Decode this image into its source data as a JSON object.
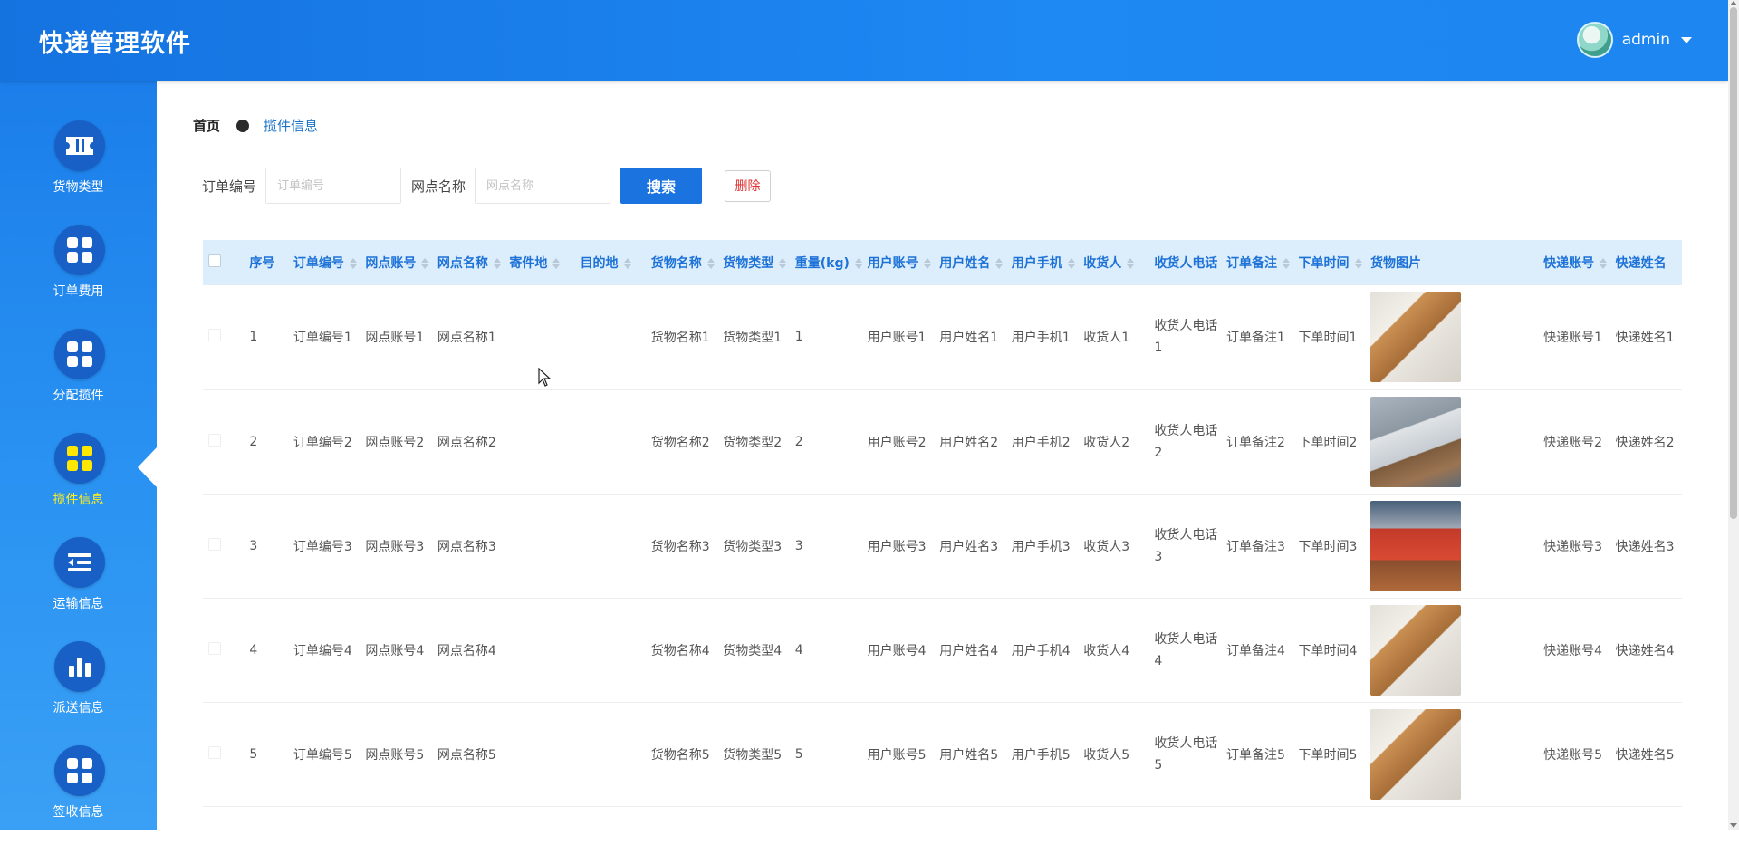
{
  "app": {
    "title": "快递管理软件"
  },
  "user": {
    "name": "admin"
  },
  "sidebar": {
    "items": [
      {
        "label": "货物类型",
        "icon": "ticket-icon"
      },
      {
        "label": "订单费用",
        "icon": "grid-icon"
      },
      {
        "label": "分配揽件",
        "icon": "grid-icon"
      },
      {
        "label": "揽件信息",
        "icon": "grid-icon",
        "active": true
      },
      {
        "label": "运输信息",
        "icon": "indent-list-icon"
      },
      {
        "label": "派送信息",
        "icon": "bar-chart-icon"
      },
      {
        "label": "签收信息",
        "icon": "grid-icon"
      }
    ]
  },
  "breadcrumb": {
    "home": "首页",
    "current": "揽件信息"
  },
  "search": {
    "order_label": "订单编号",
    "order_placeholder": "订单编号",
    "outlet_label": "网点名称",
    "outlet_placeholder": "网点名称",
    "search_button": "搜索",
    "delete_button": "删除"
  },
  "table": {
    "headers": [
      "序号",
      "订单编号",
      "网点账号",
      "网点名称",
      "寄件地",
      "目的地",
      "货物名称",
      "货物类型",
      "重量(kg)",
      "用户账号",
      "用户姓名",
      "用户手机",
      "收货人",
      "收货人电话",
      "订单备注",
      "下单时间",
      "货物图片",
      "快递账号",
      "快递姓名"
    ],
    "rows": [
      {
        "no": "1",
        "order": "订单编号1",
        "outlet_acct": "网点账号1",
        "outlet_name": "网点名称1",
        "from": "",
        "to": "",
        "goods": "货物名称1",
        "type": "货物类型1",
        "weight": "1",
        "user_acct": "用户账号1",
        "user_name": "用户姓名1",
        "user_phone": "用户手机1",
        "consignee": "收货人1",
        "consignee_phone": "收货人电话1",
        "remark": "订单备注1",
        "time": "下单时间1",
        "image": "box",
        "courier_acct": "快递账号1",
        "courier_name": "快递姓名1"
      },
      {
        "no": "2",
        "order": "订单编号2",
        "outlet_acct": "网点账号2",
        "outlet_name": "网点名称2",
        "from": "",
        "to": "",
        "goods": "货物名称2",
        "type": "货物类型2",
        "weight": "2",
        "user_acct": "用户账号2",
        "user_name": "用户姓名2",
        "user_phone": "用户手机2",
        "consignee": "收货人2",
        "consignee_phone": "收货人电话2",
        "remark": "订单备注2",
        "time": "下单时间2",
        "image": "courier",
        "courier_acct": "快递账号2",
        "courier_name": "快递姓名2"
      },
      {
        "no": "3",
        "order": "订单编号3",
        "outlet_acct": "网点账号3",
        "outlet_name": "网点名称3",
        "from": "",
        "to": "",
        "goods": "货物名称3",
        "type": "货物类型3",
        "weight": "3",
        "user_acct": "用户账号3",
        "user_name": "用户姓名3",
        "user_phone": "用户手机3",
        "consignee": "收货人3",
        "consignee_phone": "收货人电话3",
        "remark": "订单备注3",
        "time": "下单时间3",
        "image": "truck",
        "courier_acct": "快递账号3",
        "courier_name": "快递姓名3"
      },
      {
        "no": "4",
        "order": "订单编号4",
        "outlet_acct": "网点账号4",
        "outlet_name": "网点名称4",
        "from": "",
        "to": "",
        "goods": "货物名称4",
        "type": "货物类型4",
        "weight": "4",
        "user_acct": "用户账号4",
        "user_name": "用户姓名4",
        "user_phone": "用户手机4",
        "consignee": "收货人4",
        "consignee_phone": "收货人电话4",
        "remark": "订单备注4",
        "time": "下单时间4",
        "image": "box",
        "courier_acct": "快递账号4",
        "courier_name": "快递姓名4"
      },
      {
        "no": "5",
        "order": "订单编号5",
        "outlet_acct": "网点账号5",
        "outlet_name": "网点名称5",
        "from": "",
        "to": "",
        "goods": "货物名称5",
        "type": "货物类型5",
        "weight": "5",
        "user_acct": "用户账号5",
        "user_name": "用户姓名5",
        "user_phone": "用户手机5",
        "consignee": "收货人5",
        "consignee_phone": "收货人电话5",
        "remark": "订单备注5",
        "time": "下单时间5",
        "image": "box",
        "courier_acct": "快递账号5",
        "courier_name": "快递姓名5"
      }
    ]
  }
}
